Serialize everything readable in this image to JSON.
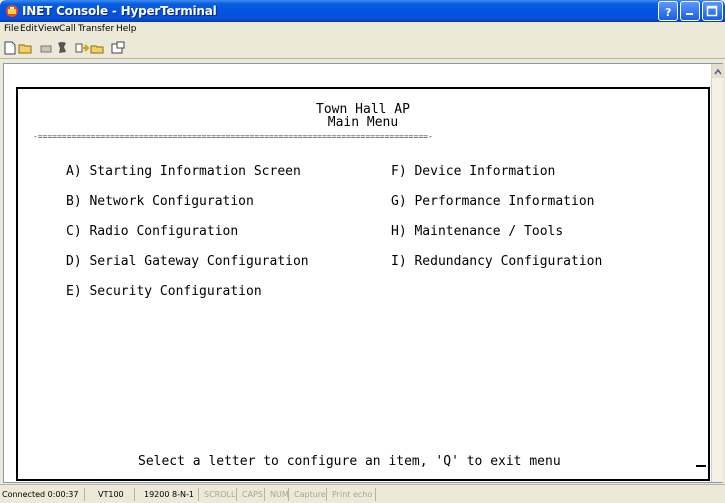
{
  "window": {
    "title": "INET Console - HyperTerminal"
  },
  "menu": {
    "items": [
      "File",
      "Edit",
      "View",
      "Call",
      "Transfer",
      "Help"
    ]
  },
  "toolbar": {
    "icons": [
      "new-icon",
      "open-icon",
      "disconnect-icon",
      "call-icon",
      "send-icon",
      "receive-icon",
      "properties-icon"
    ]
  },
  "terminal": {
    "header_title": "Town Hall AP",
    "header_subtitle": "Main Menu",
    "separator": "-=================================================================================-",
    "left_column": [
      "A) Starting Information Screen",
      "B) Network Configuration",
      "C) Radio Configuration",
      "D) Serial Gateway Configuration",
      "E) Security Configuration"
    ],
    "right_column": [
      "F) Device Information",
      "G) Performance Information",
      "H) Maintenance / Tools",
      "I) Redundancy Configuration"
    ],
    "prompt": "Select a letter to configure an item, 'Q' to exit menu"
  },
  "statusbar": {
    "connected": "Connected 0:00:37",
    "emulation": "VT100",
    "settings": "19200 8-N-1",
    "scroll": "SCROLL",
    "caps": "CAPS",
    "num": "NUM",
    "capture": "Capture",
    "print_echo": "Print echo"
  }
}
